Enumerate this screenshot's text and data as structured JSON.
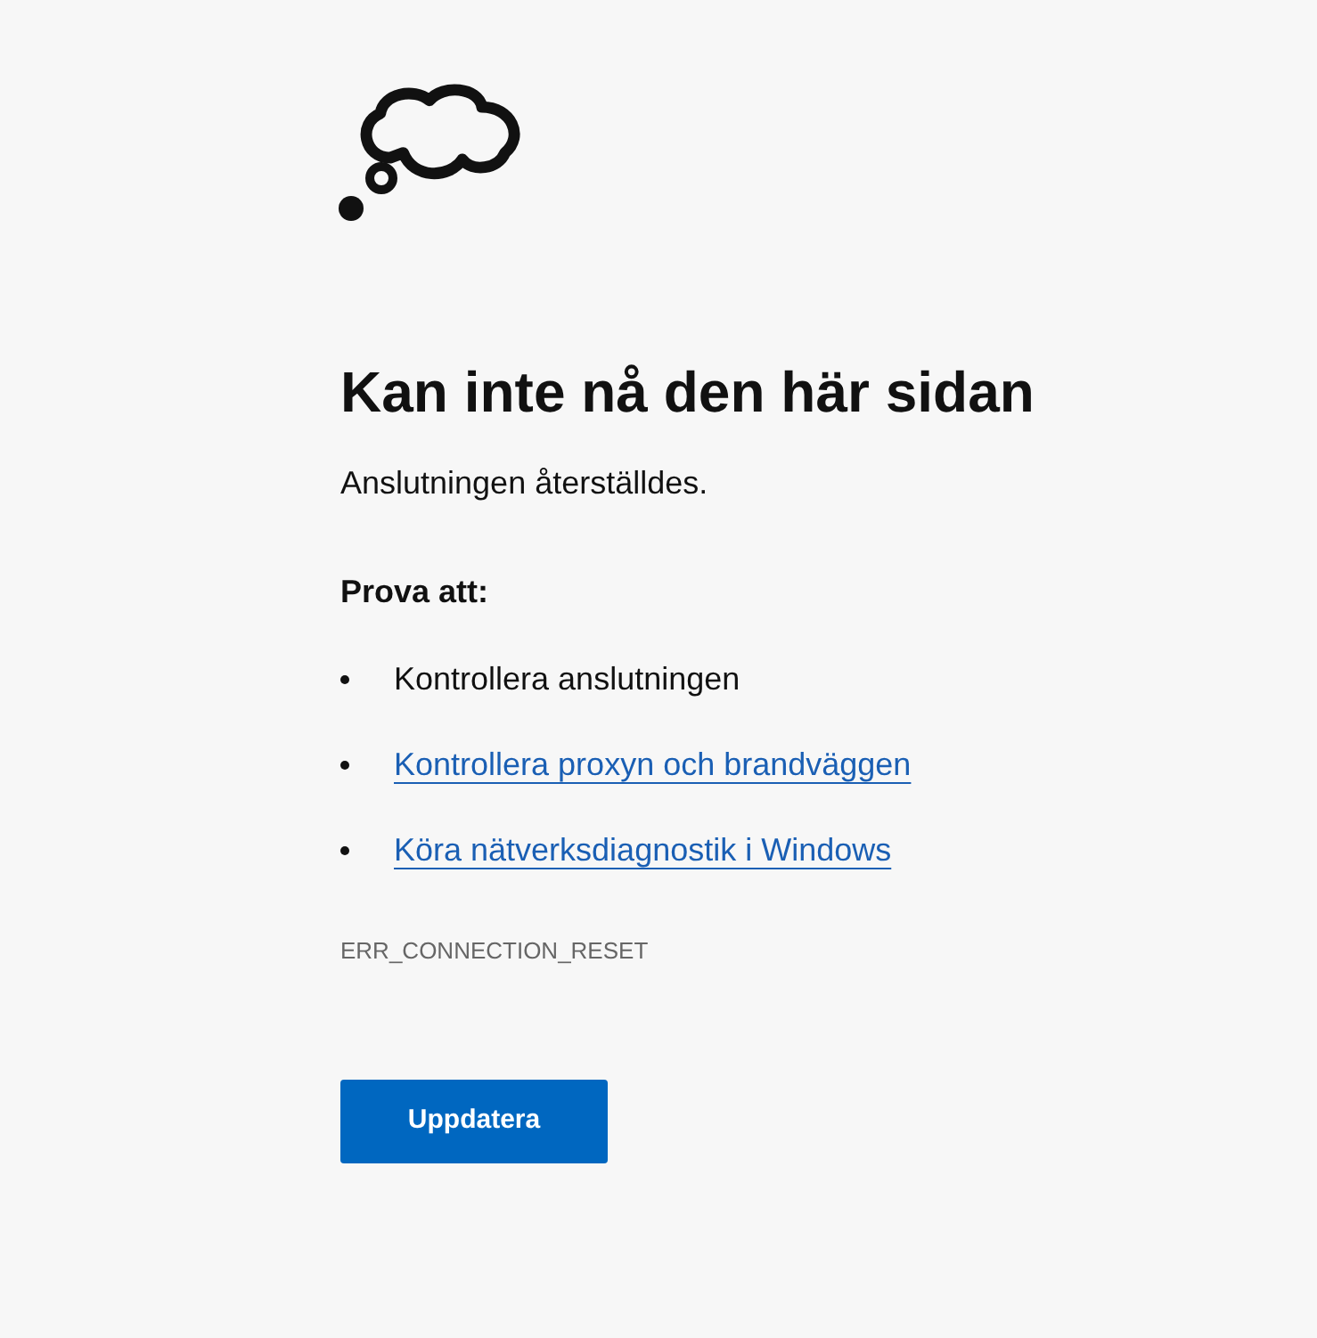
{
  "heading": "Kan inte nå den här sidan",
  "message": "Anslutningen återställdes.",
  "suggestions_title": "Prova att:",
  "suggestions": [
    {
      "kind": "text",
      "label": "Kontrollera anslutningen"
    },
    {
      "kind": "link",
      "label": "Kontrollera proxyn och brandväggen"
    },
    {
      "kind": "link",
      "label": "Köra nätverksdiagnostik i Windows"
    }
  ],
  "error_code": "ERR_CONNECTION_RESET",
  "button": "Uppdatera"
}
